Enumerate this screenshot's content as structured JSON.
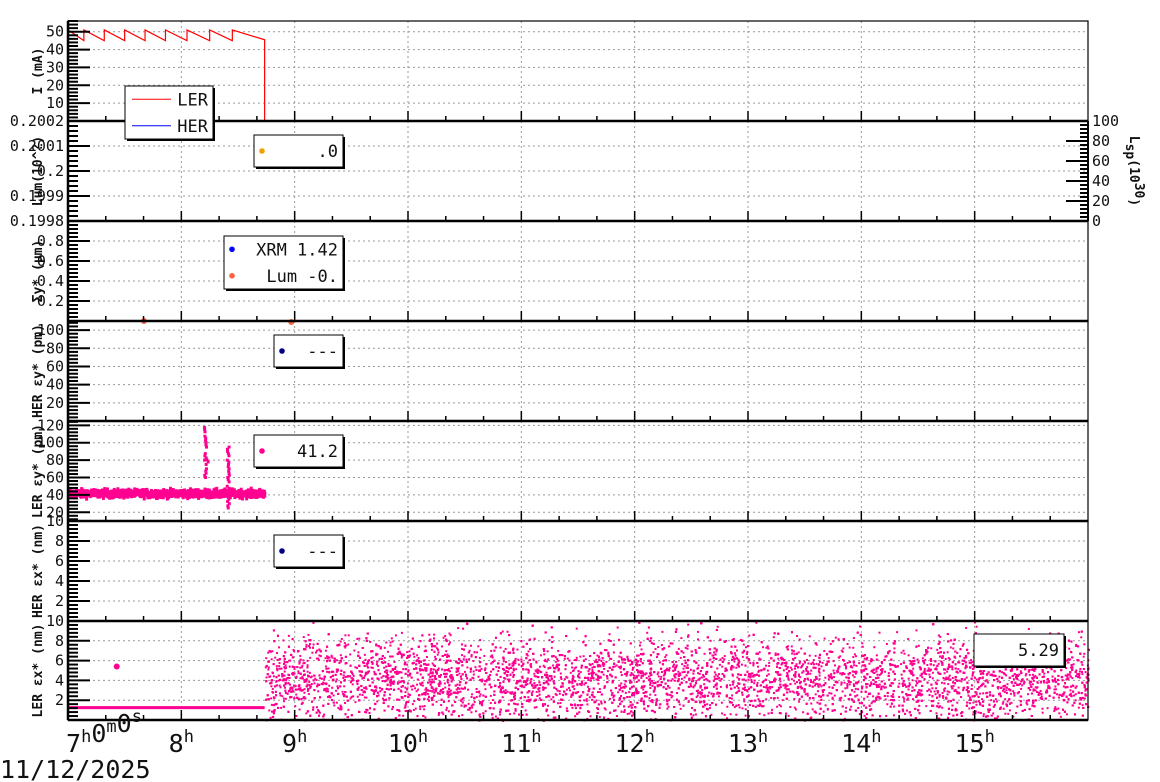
{
  "chart_data": {
    "type": "line",
    "x_unit": "hour",
    "xlim": [
      7,
      16
    ],
    "x_ticks": [
      7,
      8,
      9,
      10,
      11,
      12,
      13,
      14,
      15
    ],
    "x_tick_labels": [
      [
        [
          "7",
          "h"
        ],
        [
          "0",
          "m"
        ],
        [
          "0",
          "s"
        ]
      ],
      [
        [
          "8",
          "h"
        ]
      ],
      [
        [
          "9",
          "h"
        ]
      ],
      [
        [
          "10",
          "h"
        ]
      ],
      [
        [
          "11",
          "h"
        ]
      ],
      [
        [
          "12",
          "h"
        ]
      ],
      [
        [
          "13",
          "h"
        ]
      ],
      [
        [
          "14",
          "h"
        ]
      ],
      [
        [
          "15",
          "h"
        ]
      ]
    ],
    "date_label": "11/12/2025",
    "panels": [
      {
        "ylabel": "I (mA)",
        "ylim": [
          0,
          56
        ],
        "yticks": [
          10,
          20,
          30,
          40,
          50
        ],
        "tick_labels": [
          "10",
          "20",
          "30",
          "40",
          "50"
        ],
        "series": [
          {
            "name": "LER",
            "color": "#ff0000",
            "kind": "sawtooth",
            "x_range": [
              7,
              8.735
            ],
            "low": 45,
            "high": 51,
            "injections": [
              7.0,
              7.14,
              7.32,
              7.5,
              7.68,
              7.86,
              8.05,
              8.25,
              8.45
            ],
            "end_drop_to": 0
          },
          {
            "name": "HER",
            "color": "#0000ff",
            "kind": "constant",
            "value": 0,
            "x_range": [
              7,
              16
            ]
          }
        ],
        "legend": {
          "entries": [
            {
              "label": "LER",
              "color": "#ff0000",
              "symbol": "line"
            },
            {
              "label": "HER",
              "color": "#0000ff",
              "symbol": "line"
            }
          ]
        }
      },
      {
        "ylabel": "Lum(10^?)",
        "ylim": [
          0.1998,
          0.2002
        ],
        "yticks": [
          0.1998,
          0.1999,
          0.2,
          0.2001,
          0.2002
        ],
        "tick_labels": [
          "0.1998",
          "0.1999",
          "0.2",
          "0.2001",
          "0.2002"
        ],
        "right_axis": {
          "label": "Lsp(10^30)",
          "label_main": "L",
          "label_sub": "sp",
          "label_rest": "(10",
          "label_sup": "30",
          "label_close": ")",
          "ylim": [
            0,
            100
          ],
          "yticks": [
            0,
            20,
            40,
            60,
            80,
            100
          ],
          "tick_labels": [
            "0",
            "20",
            "40",
            "60",
            "80",
            "100"
          ]
        },
        "series": [
          {
            "name": "Lum",
            "color": "#0000cc",
            "kind": "constant",
            "value": 0.2002,
            "x_range": [
              7,
              15.7
            ]
          },
          {
            "name": "Lsp",
            "color": "#2e7d32",
            "kind": "constant",
            "value": 0.1998,
            "x_range": [
              7,
              16
            ]
          }
        ],
        "legend": {
          "entries": [
            {
              "label": ".0",
              "color": "#f0a000",
              "symbol": "dot"
            }
          ]
        }
      },
      {
        "ylabel": "Σy* (μm)",
        "ylim": [
          0,
          1
        ],
        "yticks": [
          0.2,
          0.4,
          0.6,
          0.8
        ],
        "tick_labels": [
          "0.2",
          "0.4",
          "0.6",
          "0.8"
        ],
        "series": [
          {
            "name": "Lum",
            "color": "#ff6040",
            "kind": "points",
            "x": [
              7.67,
              8.97
            ],
            "y": [
              0.0,
              -0.01
            ]
          }
        ],
        "legend": {
          "entries": [
            {
              "label": "XRM 1.42",
              "color": "#0000ff",
              "symbol": "dot"
            },
            {
              "label": "Lum -0.",
              "color": "#ff6040",
              "symbol": "dot"
            }
          ]
        }
      },
      {
        "ylabel": "HER εy* (pm)",
        "ylim": [
          0,
          110
        ],
        "yticks": [
          20,
          40,
          60,
          80,
          100
        ],
        "tick_labels": [
          "20",
          "40",
          "60",
          "80",
          "100"
        ],
        "series": [],
        "legend": {
          "entries": [
            {
              "label": "---",
              "color": "#000080",
              "symbol": "dot"
            }
          ]
        }
      },
      {
        "ylabel": "LER εy* (pm)",
        "ylim": [
          10,
          125
        ],
        "yticks": [
          20,
          40,
          60,
          80,
          100,
          120
        ],
        "tick_labels": [
          "20",
          "40",
          "60",
          "80",
          "100",
          "120"
        ],
        "series": [
          {
            "name": "LER εy*",
            "color": "#ff0090",
            "kind": "noisy",
            "x_range": [
              7,
              8.735
            ],
            "mean": 41.5,
            "spread": 3,
            "spikes": [
              {
                "x": 8.2,
                "y": [
                  60,
                  118
                ]
              },
              {
                "x": 8.22,
                "y": [
                  78,
                  82
                ]
              },
              {
                "x": 8.4,
                "y": [
                  25,
                  95
                ]
              }
            ]
          }
        ],
        "legend": {
          "entries": [
            {
              "label": "41.2",
              "color": "#ff0090",
              "symbol": "dot"
            }
          ]
        }
      },
      {
        "ylabel": "HER εx* (nm)",
        "ylim": [
          0,
          10
        ],
        "yticks": [
          2,
          4,
          6,
          8,
          10
        ],
        "tick_labels": [
          "2",
          "4",
          "6",
          "8",
          "10"
        ],
        "series": [],
        "legend": {
          "entries": [
            {
              "label": "---",
              "color": "#000080",
              "symbol": "dot"
            }
          ]
        }
      },
      {
        "ylabel": "LER εx* (nm)",
        "ylim": [
          0,
          10
        ],
        "yticks": [
          2,
          4,
          6,
          8,
          10
        ],
        "tick_labels": [
          "2",
          "4",
          "6",
          "8",
          "10"
        ],
        "series": [
          {
            "name": "LER εx* flat",
            "color": "#ff0090",
            "kind": "constant",
            "value": 1.25,
            "x_range": [
              7,
              8.735
            ]
          },
          {
            "name": "LER εx* outlier",
            "color": "#ff0090",
            "kind": "points",
            "x": [
              7.43
            ],
            "y": [
              5.4
            ]
          },
          {
            "name": "LER εx* scatter",
            "color": "#ff0090",
            "kind": "scatter",
            "x_range": [
              8.735,
              16
            ],
            "mean": 4.3,
            "sd": 2.1,
            "ymin": 0,
            "ymax": 10,
            "count": 9000
          }
        ],
        "legend": {
          "entries": [
            {
              "label": "5.29",
              "color": "#ff0090",
              "symbol": "none"
            }
          ]
        }
      }
    ]
  }
}
